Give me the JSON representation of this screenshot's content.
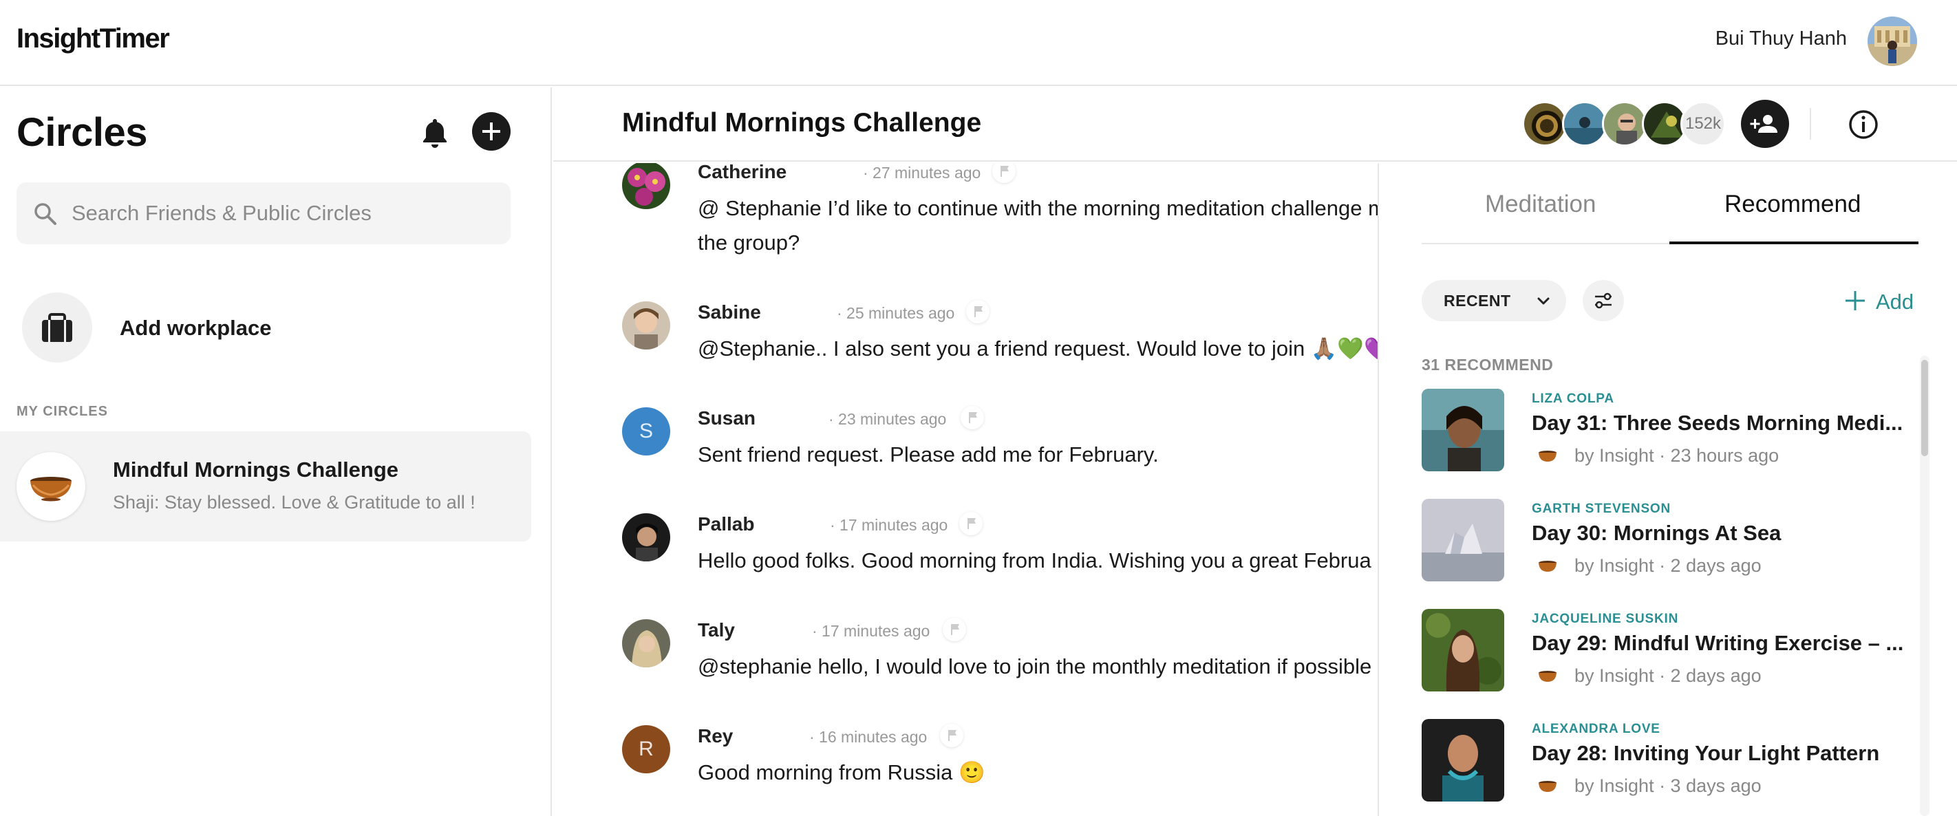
{
  "app": {
    "logo": "InsightTimer",
    "user_name": "Bui Thuy Hanh"
  },
  "sidebar": {
    "title": "Circles",
    "search_placeholder": "Search Friends & Public Circles",
    "add_workplace": "Add workplace",
    "section_label": "MY CIRCLES",
    "circles": [
      {
        "name": "Mindful Mornings Challenge",
        "preview": "Shaji: Stay blessed. Love & Gratitude to all !"
      }
    ]
  },
  "chat": {
    "title": "Mindful Mornings Challenge",
    "member_count": "152k",
    "messages": [
      {
        "name": "Catherine",
        "time": "· 27 minutes ago",
        "text": "@ Stephanie I’d like to continue with the morning meditation challenge me to the group?",
        "avatar": "flower-photo"
      },
      {
        "name": "Sabine",
        "time": "· 25 minutes ago",
        "text": "@Stephanie.. I also sent you a friend request. Would love to join 🙏🏽💚💜",
        "avatar": "portrait-photo"
      },
      {
        "name": "Susan",
        "time": "· 23 minutes ago",
        "text": "Sent friend request. Please add me for February.",
        "avatar_letter": "S",
        "avatar_color": "#3b86c9"
      },
      {
        "name": "Pallab",
        "time": "· 17 minutes ago",
        "text": "Hello good folks. Good morning from India. Wishing you a great Februa",
        "avatar": "portrait-dark"
      },
      {
        "name": "Taly",
        "time": "· 17 minutes ago",
        "text": "@stephanie hello, I would love to join the monthly meditation if possible",
        "avatar": "portrait-blonde"
      },
      {
        "name": "Rey",
        "time": "· 16 minutes ago",
        "text": "Good morning from Russia 🙂",
        "avatar_letter": "R",
        "avatar_color": "#8a4a1c"
      }
    ]
  },
  "panel": {
    "tabs": [
      {
        "label": "Meditation"
      },
      {
        "label": "Recommend"
      }
    ],
    "active_tab": "Recommend",
    "sort_label": "RECENT",
    "add_label": "Add",
    "count_label": "31 RECOMMEND",
    "items": [
      {
        "author": "LIZA COLPA",
        "title": "Day 31: Three Seeds Morning Medi...",
        "meta": "by Insight · 23 hours ago"
      },
      {
        "author": "GARTH STEVENSON",
        "title": "Day 30: Mornings At Sea",
        "meta": "by Insight · 2 days ago"
      },
      {
        "author": "JACQUELINE SUSKIN",
        "title": "Day 29: Mindful Writing Exercise – ...",
        "meta": "by Insight · 2 days ago"
      },
      {
        "author": "ALEXANDRA LOVE",
        "title": "Day 28: Inviting Your Light Pattern",
        "meta": "by Insight · 3 days ago"
      }
    ]
  },
  "colors": {
    "accent": "#2a8f92",
    "dark": "#1b1b1b",
    "muted": "#8a8a8a"
  }
}
